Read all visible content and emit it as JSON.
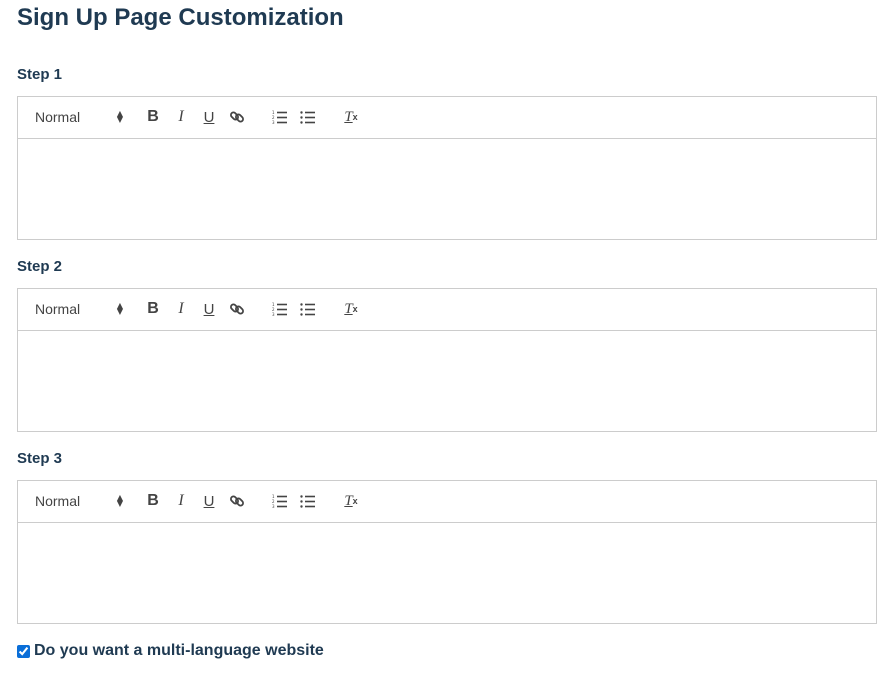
{
  "page": {
    "title": "Sign Up Page Customization"
  },
  "toolbar": {
    "format_value": "Normal",
    "bold": "B",
    "italic": "I",
    "underline": "U",
    "clean_t": "T",
    "clean_x": "x"
  },
  "steps": [
    {
      "label": "Step 1",
      "content": ""
    },
    {
      "label": "Step 2",
      "content": ""
    },
    {
      "label": "Step 3",
      "content": ""
    }
  ],
  "multilang": {
    "label": "Do you want a multi-language website",
    "checked": true
  }
}
